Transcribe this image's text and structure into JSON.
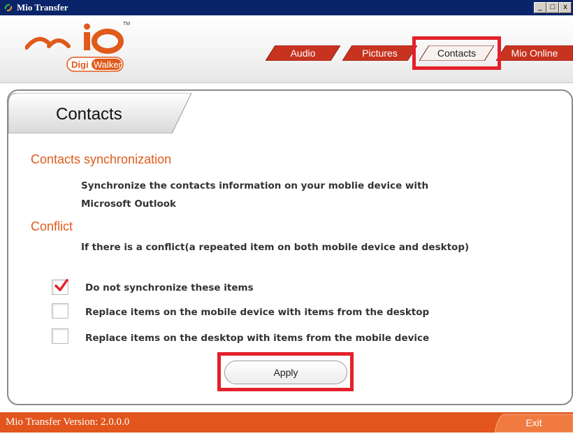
{
  "window": {
    "title": "Mio Transfer",
    "controls": {
      "minimize": "_",
      "maximize": "□",
      "close": "x"
    }
  },
  "logo": {
    "brand": "Mio",
    "tm": "TM",
    "sub_brand_left": "Digi",
    "sub_brand_right": "Walker"
  },
  "tabs": [
    {
      "label": "Audio",
      "active": false
    },
    {
      "label": "Pictures",
      "active": false
    },
    {
      "label": "Contacts",
      "active": true
    },
    {
      "label": "Mio Online",
      "active": false
    }
  ],
  "panel": {
    "title": "Contacts",
    "sync_heading": "Contacts synchronization",
    "sync_desc_line1": "Synchronize the contacts information on your moblie device with",
    "sync_desc_line2": "Microsoft Outlook",
    "conflict_heading": "Conflict",
    "conflict_desc": "If there is a conflict(a repeated item on both mobile device and desktop)",
    "options": [
      {
        "label": "Do not synchronize these items",
        "checked": true
      },
      {
        "label": "Replace items on the mobile device with items from the desktop",
        "checked": false
      },
      {
        "label": "Replace items on the desktop with items from the mobile device",
        "checked": false
      }
    ],
    "apply_label": "Apply"
  },
  "footer": {
    "version": "Mio Transfer Version: 2.0.0.0",
    "exit_label": "Exit"
  },
  "colors": {
    "accent": "#e05a1b",
    "footer": "#e2551c",
    "tab_red": "#c8331f",
    "highlight": "#e4202b",
    "titlebar": "#0a246a"
  }
}
